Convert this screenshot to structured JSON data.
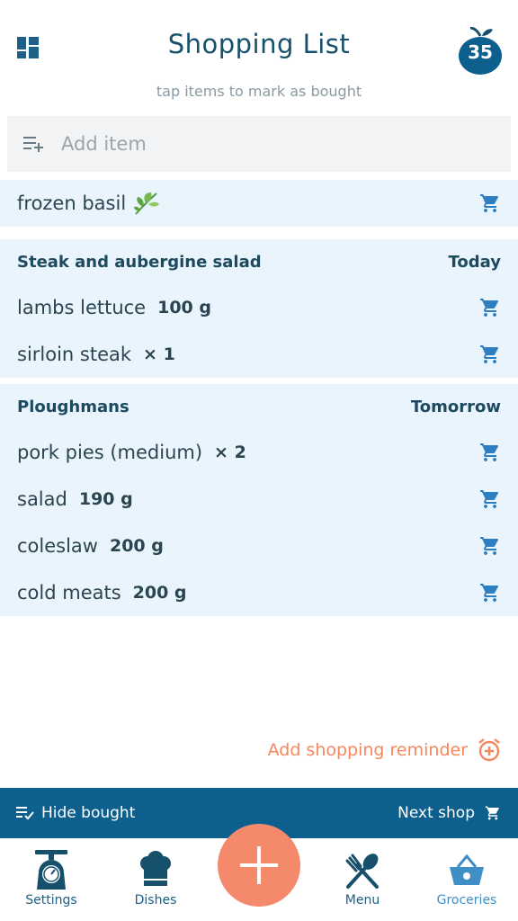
{
  "header": {
    "title": "Shopping List",
    "subtitle": "tap items to mark as bought",
    "apple_count": "35",
    "menu_icon": "dashboard-icon",
    "badge_icon": "apple-icon"
  },
  "add_item": {
    "placeholder": "Add item",
    "icon": "playlist-add-icon"
  },
  "loose_items": [
    {
      "name": "frozen basil",
      "icon": "herb-leaf-icon"
    }
  ],
  "groups": [
    {
      "meal": "Steak and aubergine salad",
      "when": "Today",
      "items": [
        {
          "name": "lambs lettuce",
          "qty": "100 g"
        },
        {
          "name": "sirloin steak",
          "qty": "× 1"
        }
      ]
    },
    {
      "meal": "Ploughmans",
      "when": "Tomorrow",
      "items": [
        {
          "name": "pork pies (medium)",
          "qty": "× 2"
        },
        {
          "name": "salad",
          "qty": "190 g"
        },
        {
          "name": "coleslaw",
          "qty": "200 g"
        },
        {
          "name": "cold meats",
          "qty": "200 g"
        }
      ]
    }
  ],
  "reminder": {
    "label": "Add shopping reminder"
  },
  "toolbar": {
    "hide_bought": "Hide bought",
    "next_shop": "Next shop"
  },
  "nav": {
    "settings": "Settings",
    "dishes": "Dishes",
    "menu": "Menu",
    "groceries": "Groceries",
    "active": "groceries"
  },
  "colors": {
    "primary": "#0d5f8d",
    "accent": "#f5896c",
    "list_bg": "#eaf4fd",
    "cart_icon": "#2f7fc0"
  }
}
